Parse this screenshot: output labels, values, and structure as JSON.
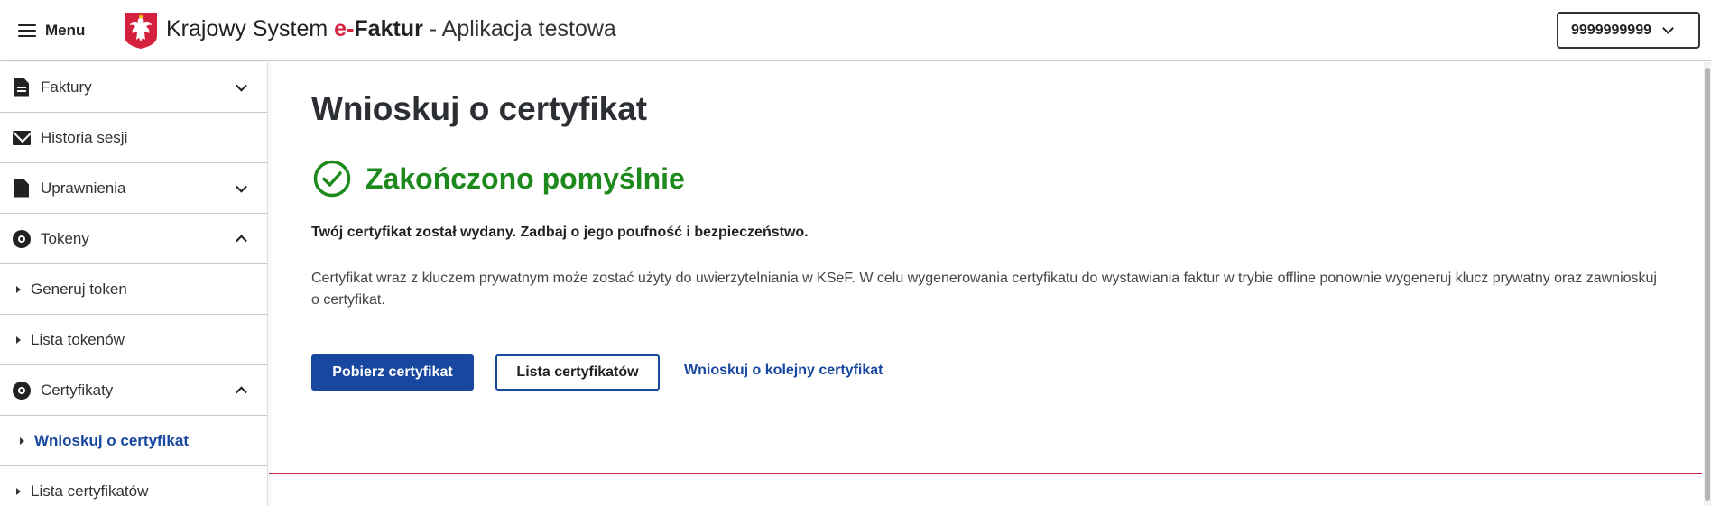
{
  "header": {
    "menu_label": "Menu",
    "title_prefix": "Krajowy System",
    "title_e": "e-",
    "title_brand": "Faktur",
    "title_suffix": " - Aplikacja testowa",
    "nip_value": "9999999999"
  },
  "sidebar": {
    "items": [
      {
        "label": "Faktury",
        "icon": "document-icon",
        "state": "collapsed"
      },
      {
        "label": "Historia sesji",
        "icon": "mail-icon"
      },
      {
        "label": "Uprawnienia",
        "icon": "document-icon",
        "state": "collapsed"
      },
      {
        "label": "Tokeny",
        "icon": "disc-icon",
        "state": "expanded"
      },
      {
        "label": "Generuj token",
        "sub": true
      },
      {
        "label": "Lista tokenów",
        "sub": true
      },
      {
        "label": "Certyfikaty",
        "icon": "disc-icon",
        "state": "expanded"
      },
      {
        "label": "Wnioskuj o certyfikat",
        "sub": true,
        "active": true
      },
      {
        "label": "Lista certyfikatów",
        "sub": true
      }
    ]
  },
  "main": {
    "page_title": "Wnioskuj o certyfikat",
    "success_title": "Zakończono pomyślnie",
    "lead": "Twój certyfikat został wydany. Zadbaj o jego poufność i bezpieczeństwo.",
    "description": "Certyfikat wraz z kluczem prywatnym może zostać użyty do uwierzytelniania w KSeF. W celu wygenerowania certyfikatu do wystawiania faktur w trybie offline ponownie wygeneruj klucz prywatny oraz zawnioskuj o certyfikat.",
    "download_button": "Pobierz certyfikat",
    "list_button": "Lista certyfikatów",
    "next_link": "Wnioskuj o kolejny certyfikat"
  },
  "colors": {
    "primary": "#17479e",
    "success": "#1e8a1e",
    "brand_red": "#d4213d"
  }
}
